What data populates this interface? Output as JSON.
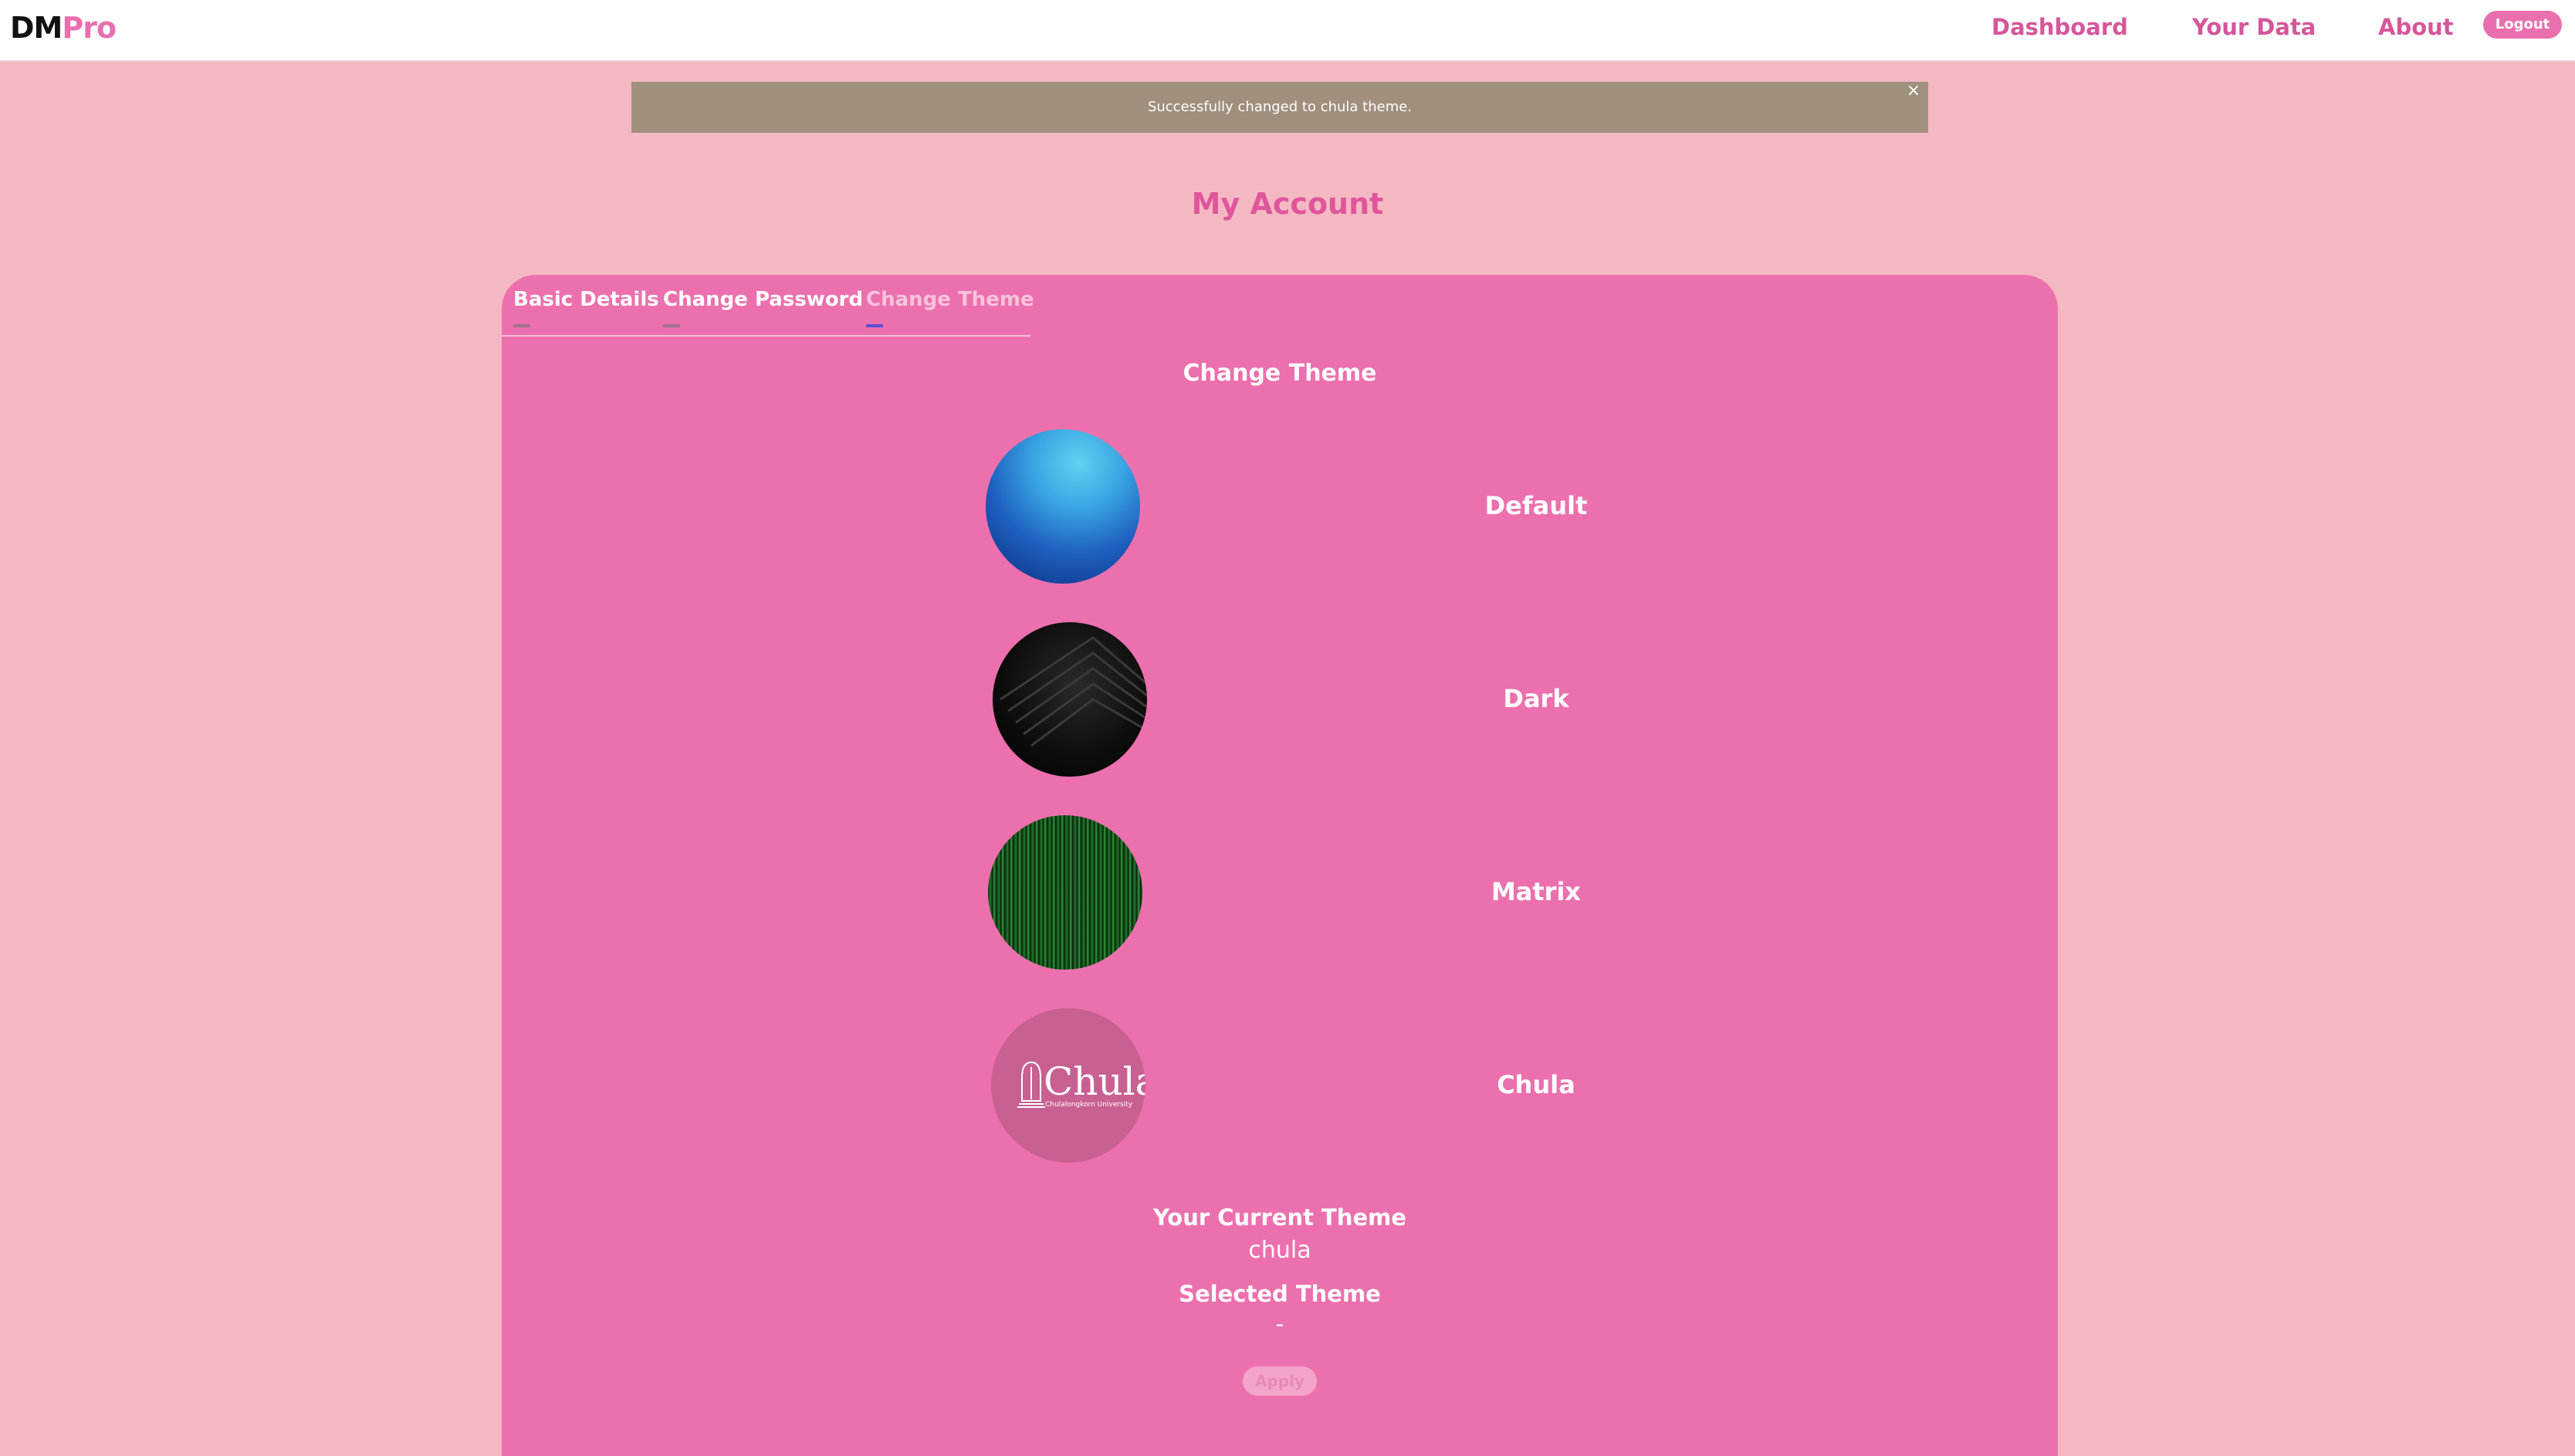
{
  "brand": {
    "part1": "DM",
    "part2": "Pro"
  },
  "nav": {
    "dashboard": "Dashboard",
    "your_data": "Your Data",
    "about": "About",
    "logout": "Logout"
  },
  "alert": {
    "message": "Successfully changed to chula theme.",
    "close": "×"
  },
  "page": {
    "title": "My Account"
  },
  "tabs": [
    {
      "label": "Basic Details"
    },
    {
      "label": "Change Password"
    },
    {
      "label": "Change Theme"
    }
  ],
  "section": {
    "title": "Change Theme"
  },
  "themes": [
    {
      "name": "Default"
    },
    {
      "name": "Dark"
    },
    {
      "name": "Matrix"
    },
    {
      "name": "Chula",
      "logo_text": "Chula",
      "logo_subtext": "Chulalongkorn University"
    }
  ],
  "current": {
    "label": "Your Current Theme",
    "value": "chula"
  },
  "selected": {
    "label": "Selected Theme",
    "value": "-"
  },
  "apply": {
    "label": "Apply"
  },
  "colors": {
    "page_bg": "#f4b8c2",
    "card_bg": "#ec70ae",
    "accent": "#ea6fae",
    "alert_bg": "#a08f7c"
  }
}
